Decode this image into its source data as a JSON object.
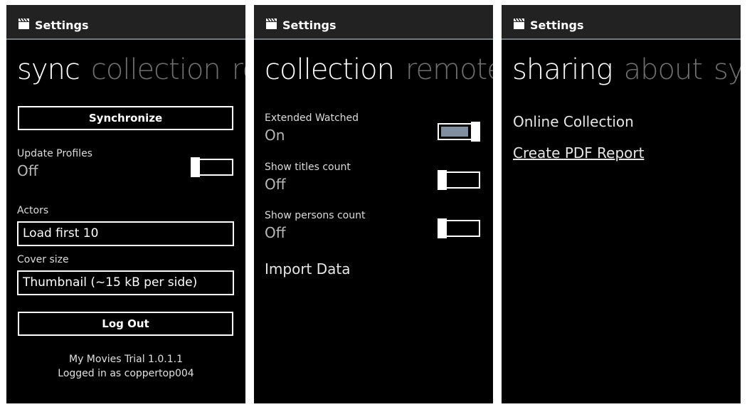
{
  "app": {
    "title": "Settings",
    "icon": "clapperboard-icon"
  },
  "colors": {
    "background": "#000000",
    "titlebar": "#222222",
    "accent": "#7f8fa0",
    "inactive_pivot": "#6e6e6e"
  },
  "screen1": {
    "pivot": {
      "active": "sync",
      "next1": "collection",
      "next2": "re"
    },
    "synchronize_label": "Synchronize",
    "update_profiles": {
      "label": "Update Profiles",
      "state": "Off"
    },
    "actors": {
      "label": "Actors",
      "value": "Load first 10"
    },
    "cover_size": {
      "label": "Cover size",
      "value": "Thumbnail (~15 kB per side)"
    },
    "logout_label": "Log Out",
    "footer": {
      "version": "My Movies Trial 1.0.1.1",
      "logged_in": "Logged in as coppertop004"
    }
  },
  "screen2": {
    "pivot": {
      "active": "collection",
      "next1": "remote"
    },
    "extended_watched": {
      "label": "Extended Watched",
      "state": "On"
    },
    "show_titles_count": {
      "label": "Show titles count",
      "state": "Off"
    },
    "show_persons_count": {
      "label": "Show persons count",
      "state": "Off"
    },
    "import_data": "Import Data"
  },
  "screen3": {
    "pivot": {
      "active": "sharing",
      "next1": "about",
      "next2": "syn"
    },
    "online_collection": "Online Collection",
    "create_pdf_report": "Create PDF Report"
  }
}
